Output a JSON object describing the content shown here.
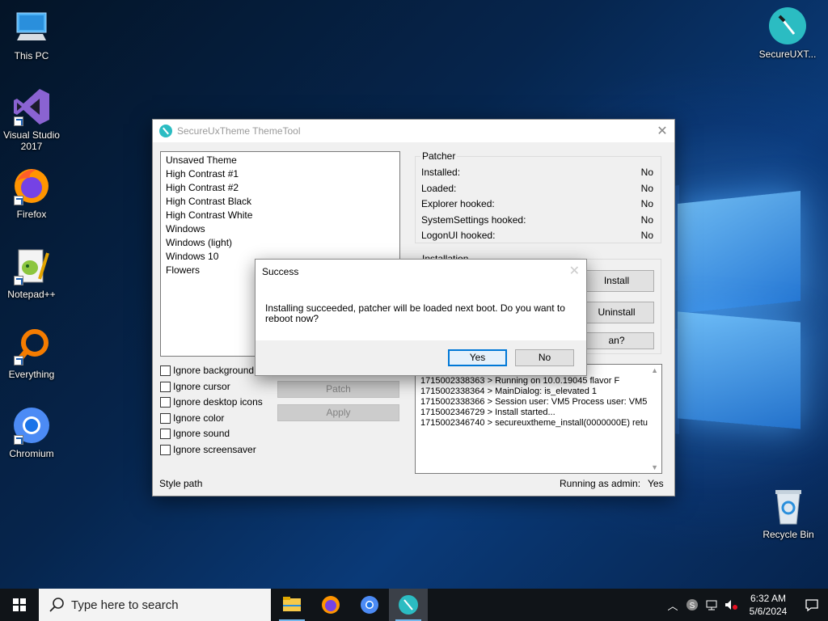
{
  "desktop": {
    "icons": [
      {
        "label": "This PC"
      },
      {
        "label": "Visual Studio 2017"
      },
      {
        "label": "Firefox"
      },
      {
        "label": "Notepad++"
      },
      {
        "label": "Everything"
      },
      {
        "label": "Chromium"
      },
      {
        "label": "SecureUXT..."
      },
      {
        "label": "Recycle Bin"
      }
    ]
  },
  "window": {
    "title": "SecureUxTheme ThemeTool",
    "themes": [
      "Unsaved Theme",
      "High Contrast #1",
      "High Contrast #2",
      "High Contrast Black",
      "High Contrast White",
      "Windows",
      "Windows (light)",
      "Windows 10",
      "Flowers"
    ],
    "patcher": {
      "title": "Patcher",
      "rows": [
        {
          "label": "Installed:",
          "value": "No"
        },
        {
          "label": "Loaded:",
          "value": "No"
        },
        {
          "label": "Explorer hooked:",
          "value": "No"
        },
        {
          "label": "SystemSettings hooked:",
          "value": "No"
        },
        {
          "label": "LogonUI hooked:",
          "value": "No"
        }
      ]
    },
    "installation": {
      "title": "Installation",
      "install_label": "Install",
      "uninstall_label": "Uninstall",
      "third_partial": "an?"
    },
    "options": [
      "Ignore background",
      "Ignore cursor",
      "Ignore desktop icons",
      "Ignore color",
      "Ignore sound",
      "Ignore screensaver"
    ],
    "patch_label": "Patch",
    "apply_label": "Apply",
    "log": [
      "1715002338363 > Running on 10.0.19045 flavor F",
      "1715002338364 > MainDialog: is_elevated 1",
      "1715002338366 > Session user: VM5 Process user: VM5",
      "1715002346729 > Install started...",
      "1715002346740 > secureuxtheme_install(0000000E) retu"
    ],
    "style_path_label": "Style path",
    "admin_label": "Running as admin:",
    "admin_value": "Yes"
  },
  "dialog": {
    "title": "Success",
    "message": "Installing succeeded, patcher will be loaded next boot. Do you want to reboot now?",
    "yes_label": "Yes",
    "no_label": "No"
  },
  "taskbar": {
    "search_placeholder": "Type here to search",
    "time": "6:32 AM",
    "date": "5/6/2024"
  },
  "colors": {
    "accent": "#0078d7",
    "app_teal": "#2bbcc2",
    "taskbar": "#101418"
  }
}
